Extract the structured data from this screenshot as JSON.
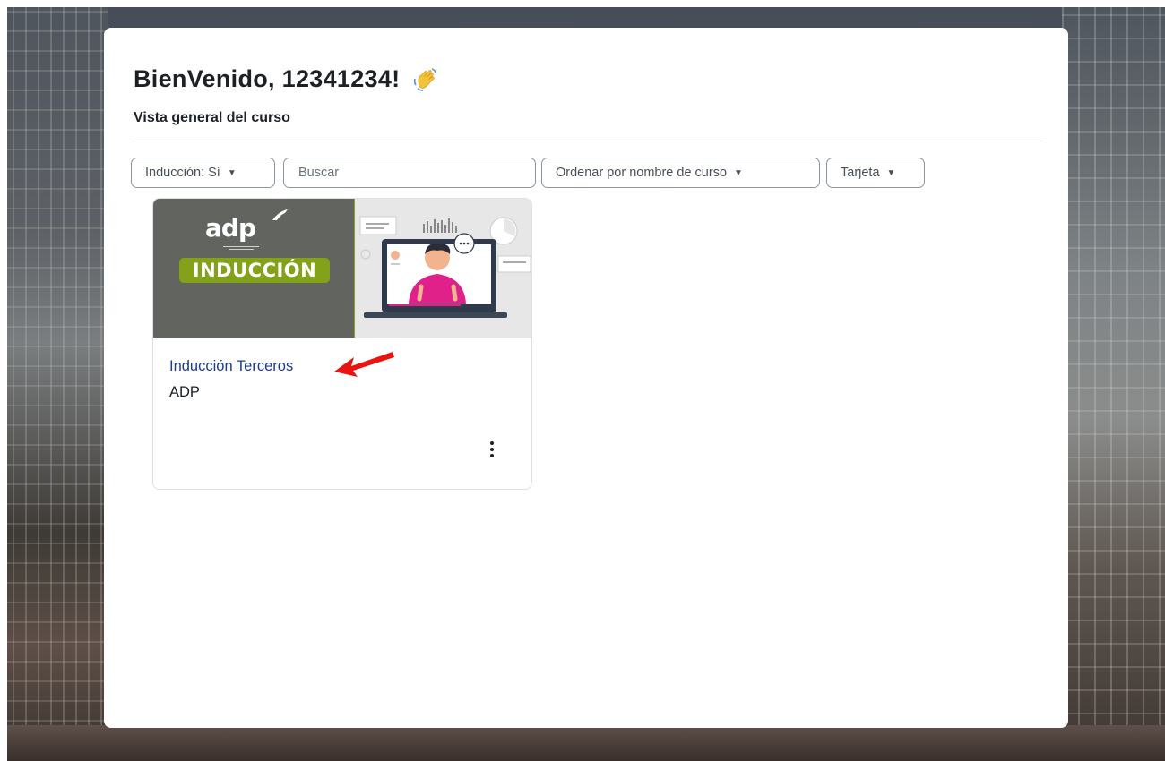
{
  "welcome": {
    "title": "BienVenido, 12341234!",
    "icon": "waving-hand-icon"
  },
  "overview": {
    "subtitle": "Vista general del curso"
  },
  "filters": {
    "grouping_label": "Inducción: Sí",
    "search_placeholder": "Buscar",
    "sort_label": "Ordenar por nombre de curso",
    "view_label": "Tarjeta"
  },
  "course": {
    "image_logo": "adp",
    "image_badge": "INDUCCIÓN",
    "name": "Inducción Terceros",
    "category": "ADP",
    "menu_icon": "kebab-menu-icon"
  },
  "annotation": {
    "arrow_color": "#e8140f"
  },
  "colors": {
    "link": "#1b3c8f",
    "badge_green": "#84a11a",
    "image_grey": "#626460",
    "figure_shirt": "#e0218a"
  }
}
